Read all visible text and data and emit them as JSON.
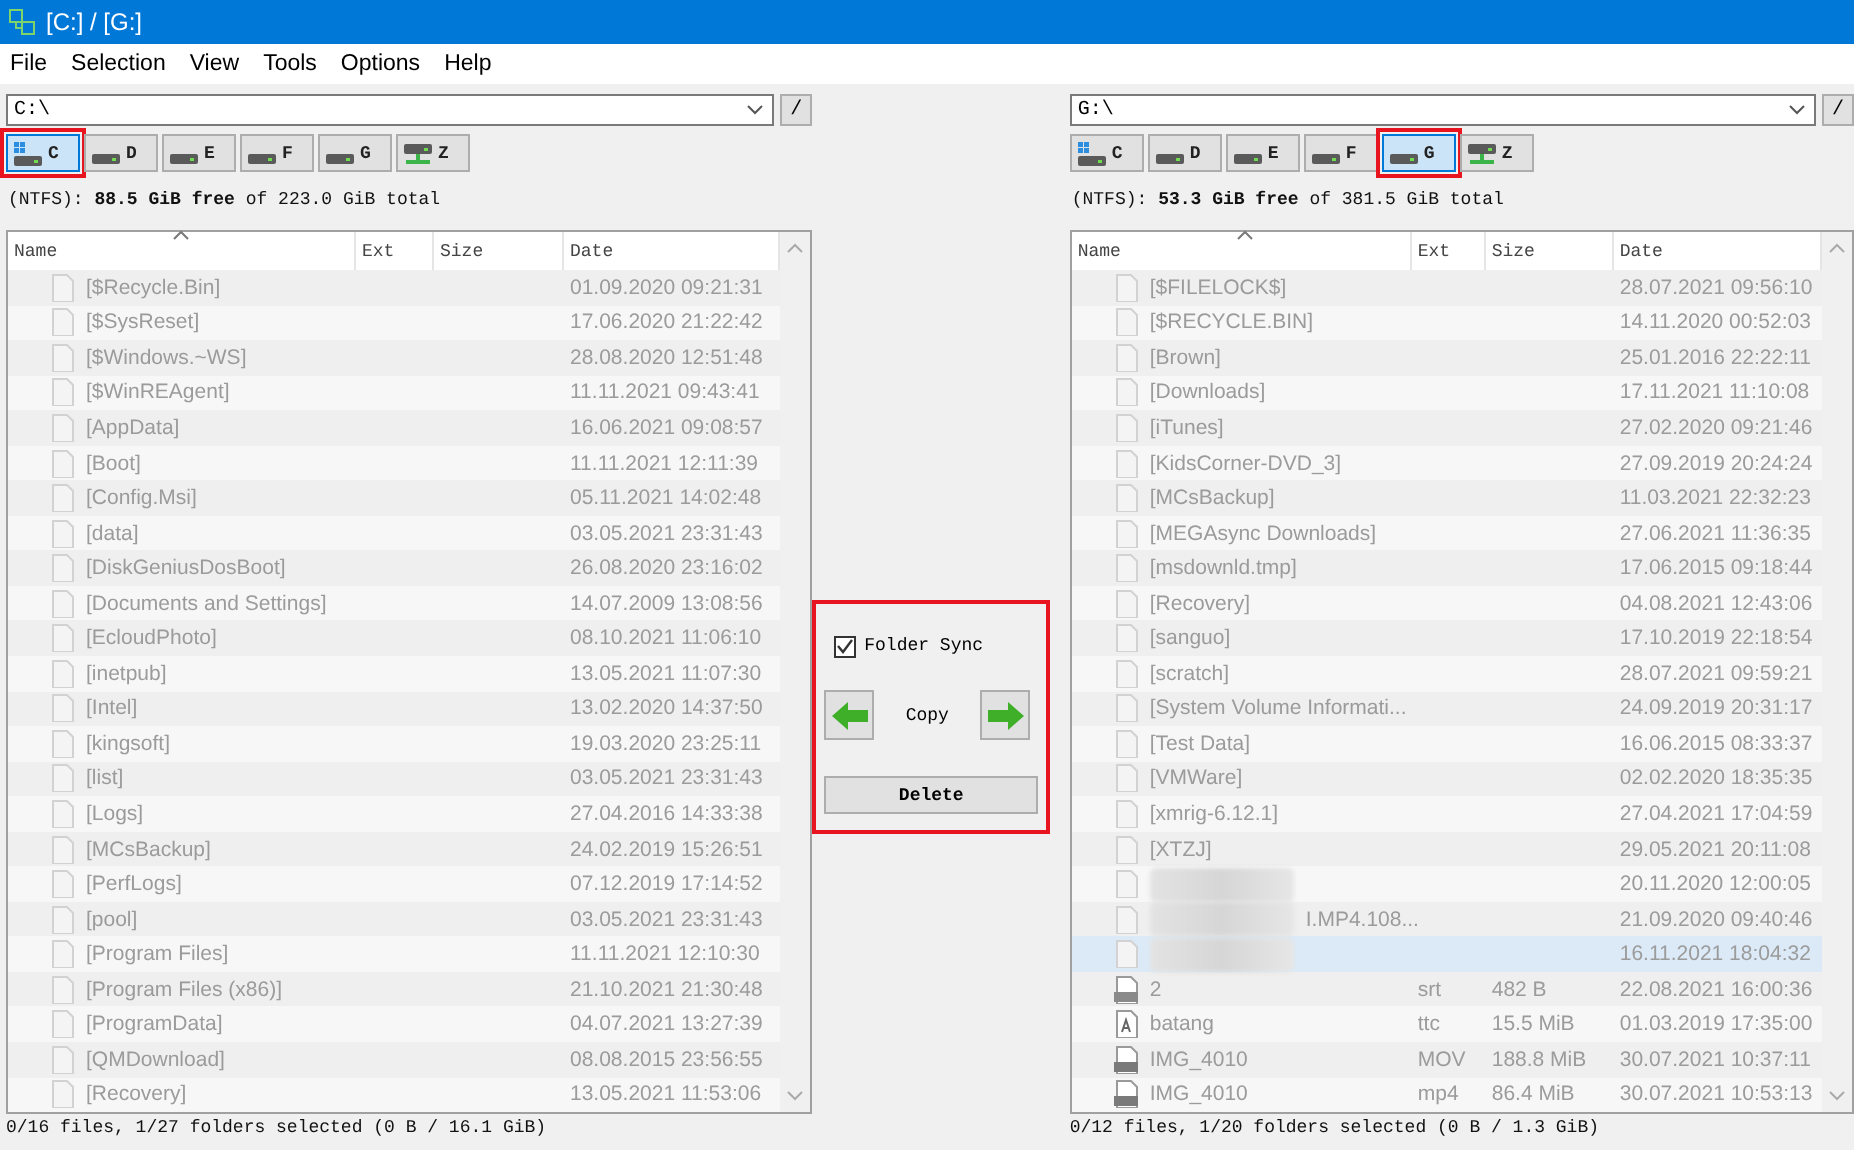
{
  "window": {
    "title": "[C:] / [G:]"
  },
  "menu": [
    "File",
    "Selection",
    "View",
    "Tools",
    "Options",
    "Help"
  ],
  "panes": [
    {
      "path": "C:\\",
      "root_button": "/",
      "drives": [
        {
          "label": "C",
          "kind": "system",
          "selected": true,
          "highlighted": true
        },
        {
          "label": "D",
          "kind": "disk",
          "selected": false,
          "highlighted": false
        },
        {
          "label": "E",
          "kind": "disk",
          "selected": false,
          "highlighted": false
        },
        {
          "label": "F",
          "kind": "disk",
          "selected": false,
          "highlighted": false
        },
        {
          "label": "G",
          "kind": "disk",
          "selected": false,
          "highlighted": false
        },
        {
          "label": "Z",
          "kind": "network",
          "selected": false,
          "highlighted": false
        }
      ],
      "info": "(NTFS): **88.5 GiB free** of 223.0 GiB total",
      "columns": [
        "Name",
        "Ext",
        "Size",
        "Date"
      ],
      "rows": [
        {
          "kind": "folder",
          "name": "[$Recycle.Bin]",
          "date": "01.09.2020 09:21:31",
          "selected": false
        },
        {
          "kind": "folder",
          "name": "[$SysReset]",
          "date": "17.06.2020 21:22:42",
          "selected": false
        },
        {
          "kind": "folder",
          "name": "[$Windows.~WS]",
          "date": "28.08.2020 12:51:48",
          "selected": false
        },
        {
          "kind": "folder",
          "name": "[$WinREAgent]",
          "date": "11.11.2021 09:43:41",
          "selected": false
        },
        {
          "kind": "folder",
          "name": "[AppData]",
          "date": "16.06.2021 09:08:57",
          "selected": false
        },
        {
          "kind": "folder",
          "name": "[Boot]",
          "date": "11.11.2021 12:11:39",
          "selected": false
        },
        {
          "kind": "folder",
          "name": "[Config.Msi]",
          "date": "05.11.2021 14:02:48",
          "selected": false
        },
        {
          "kind": "folder",
          "name": "[data]",
          "date": "03.05.2021 23:31:43",
          "selected": false
        },
        {
          "kind": "folder",
          "name": "[DiskGeniusDosBoot]",
          "date": "26.08.2020 23:16:02",
          "selected": false
        },
        {
          "kind": "folder",
          "name": "[Documents and Settings]",
          "date": "14.07.2009 13:08:56",
          "selected": false
        },
        {
          "kind": "folder",
          "name": "[EcloudPhoto]",
          "date": "08.10.2021 11:06:10",
          "selected": false
        },
        {
          "kind": "folder",
          "name": "[inetpub]",
          "date": "13.05.2021 11:07:30",
          "selected": false
        },
        {
          "kind": "folder",
          "name": "[Intel]",
          "date": "13.02.2020 14:37:50",
          "selected": false
        },
        {
          "kind": "folder",
          "name": "[kingsoft]",
          "date": "19.03.2020 23:25:11",
          "selected": false
        },
        {
          "kind": "folder",
          "name": "[list]",
          "date": "03.05.2021 23:31:43",
          "selected": false
        },
        {
          "kind": "folder",
          "name": "[Logs]",
          "date": "27.04.2016 14:33:38",
          "selected": false
        },
        {
          "kind": "folder",
          "name": "[MCsBackup]",
          "date": "24.02.2019 15:26:51",
          "selected": false
        },
        {
          "kind": "folder",
          "name": "[PerfLogs]",
          "date": "07.12.2019 17:14:52",
          "selected": false
        },
        {
          "kind": "folder",
          "name": "[pool]",
          "date": "03.05.2021 23:31:43",
          "selected": false
        },
        {
          "kind": "folder",
          "name": "[Program Files]",
          "date": "11.11.2021 12:10:30",
          "selected": false
        },
        {
          "kind": "folder",
          "name": "[Program Files (x86)]",
          "date": "21.10.2021 21:30:48",
          "selected": false
        },
        {
          "kind": "folder",
          "name": "[ProgramData]",
          "date": "04.07.2021 13:27:39",
          "selected": false
        },
        {
          "kind": "folder",
          "name": "[QMDownload]",
          "date": "08.08.2015 23:56:55",
          "selected": false
        },
        {
          "kind": "folder",
          "name": "[Recovery]",
          "date": "13.05.2021 11:53:06",
          "selected": false
        }
      ],
      "status": "0/16 files, 1/27 folders selected (0 B / 16.1 GiB)"
    },
    {
      "path": "G:\\",
      "root_button": "/",
      "drives": [
        {
          "label": "C",
          "kind": "system",
          "selected": false,
          "highlighted": false
        },
        {
          "label": "D",
          "kind": "disk",
          "selected": false,
          "highlighted": false
        },
        {
          "label": "E",
          "kind": "disk",
          "selected": false,
          "highlighted": false
        },
        {
          "label": "F",
          "kind": "disk",
          "selected": false,
          "highlighted": false
        },
        {
          "label": "G",
          "kind": "disk",
          "selected": true,
          "highlighted": true
        },
        {
          "label": "Z",
          "kind": "network",
          "selected": false,
          "highlighted": false
        }
      ],
      "info": "(NTFS): **53.3 GiB free** of 381.5 GiB total",
      "columns": [
        "Name",
        "Ext",
        "Size",
        "Date"
      ],
      "rows": [
        {
          "kind": "folder",
          "name": "[$FILELOCK$]",
          "date": "28.07.2021 09:56:10",
          "selected": false
        },
        {
          "kind": "folder",
          "name": "[$RECYCLE.BIN]",
          "date": "14.11.2020 00:52:03",
          "selected": false
        },
        {
          "kind": "folder",
          "name": "[Brown]",
          "date": "25.01.2016 22:22:11",
          "selected": false
        },
        {
          "kind": "folder",
          "name": "[Downloads]",
          "date": "17.11.2021 11:10:08",
          "selected": false
        },
        {
          "kind": "folder",
          "name": "[iTunes]",
          "date": "27.02.2020 09:21:46",
          "selected": false
        },
        {
          "kind": "folder",
          "name": "[KidsCorner-DVD_3]",
          "date": "27.09.2019 20:24:24",
          "selected": false
        },
        {
          "kind": "folder",
          "name": "[MCsBackup]",
          "date": "11.03.2021 22:32:23",
          "selected": false
        },
        {
          "kind": "folder",
          "name": "[MEGAsync Downloads]",
          "date": "27.06.2021 11:36:35",
          "selected": false
        },
        {
          "kind": "folder",
          "name": "[msdownld.tmp]",
          "date": "17.06.2015 09:18:44",
          "selected": false
        },
        {
          "kind": "folder",
          "name": "[Recovery]",
          "date": "04.08.2021 12:43:06",
          "selected": false
        },
        {
          "kind": "folder",
          "name": "[sanguo]",
          "date": "17.10.2019 22:18:54",
          "selected": false
        },
        {
          "kind": "folder",
          "name": "[scratch]",
          "date": "28.07.2021 09:59:21",
          "selected": false
        },
        {
          "kind": "folder",
          "name": "[System Volume Informati...",
          "date": "24.09.2019 20:31:17",
          "selected": false
        },
        {
          "kind": "folder",
          "name": "[Test Data]",
          "date": "16.06.2015 08:33:37",
          "selected": false
        },
        {
          "kind": "folder",
          "name": "[VMWare]",
          "date": "02.02.2020 18:35:35",
          "selected": false
        },
        {
          "kind": "folder",
          "name": "[xmrig-6.12.1]",
          "date": "27.04.2021 17:04:59",
          "selected": false
        },
        {
          "kind": "folder",
          "name": "[XTZJ]",
          "date": "29.05.2021 20:11:08",
          "selected": false
        },
        {
          "kind": "redacted",
          "date": "20.11.2020 12:00:05",
          "selected": false
        },
        {
          "kind": "redacted",
          "name": "I.MP4.108...",
          "date": "21.09.2020 09:40:46",
          "selected": false
        },
        {
          "kind": "redacted",
          "date": "16.11.2021 18:04:32",
          "selected": true
        },
        {
          "kind": "subtitle",
          "name": "2",
          "ext": "srt",
          "size": "482 B",
          "date": "22.08.2021 16:00:36",
          "selected": false
        },
        {
          "kind": "font",
          "name": "batang",
          "ext": "ttc",
          "size": "15.5 MiB",
          "date": "01.03.2019 17:35:00",
          "selected": false
        },
        {
          "kind": "video",
          "name": "IMG_4010",
          "ext": "MOV",
          "size": "188.8 MiB",
          "date": "30.07.2021 10:37:11",
          "selected": false
        },
        {
          "kind": "video",
          "name": "IMG_4010",
          "ext": "mp4",
          "size": "86.4 MiB",
          "date": "30.07.2021 10:53:13",
          "selected": false
        }
      ],
      "status": "0/12 files, 1/20 folders selected (0 B / 1.3 GiB)"
    }
  ],
  "sync_panel": {
    "highlighted": true,
    "folder_sync": {
      "label": "Folder Sync",
      "checked": true
    },
    "copy_label": "Copy",
    "delete_label": "Delete"
  }
}
